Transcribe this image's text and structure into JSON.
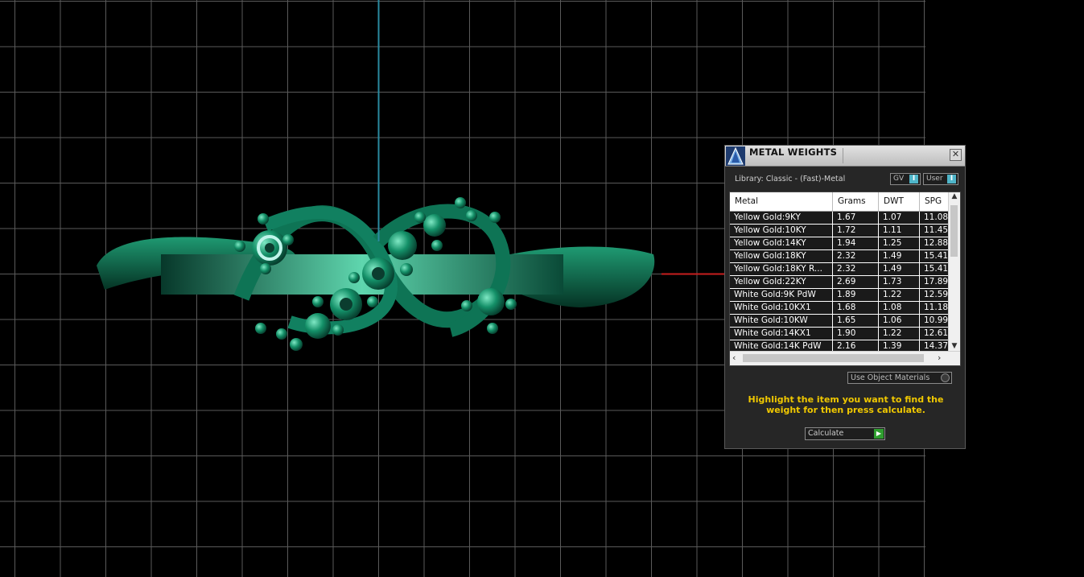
{
  "panel": {
    "title": "METAL WEIGHTS",
    "close_icon": "close-icon",
    "library_label": "Library: Classic - (Fast)-Metal",
    "toggles": [
      {
        "label": "GV"
      },
      {
        "label": "User"
      }
    ],
    "table": {
      "columns": [
        "Metal",
        "Grams",
        "DWT",
        "SPG"
      ],
      "rows": [
        [
          "Yellow Gold:9KY",
          "1.67",
          "1.07",
          "11.08"
        ],
        [
          "Yellow Gold:10KY",
          "1.72",
          "1.11",
          "11.45"
        ],
        [
          "Yellow Gold:14KY",
          "1.94",
          "1.25",
          "12.88"
        ],
        [
          "Yellow Gold:18KY",
          "2.32",
          "1.49",
          "15.41"
        ],
        [
          "Yellow Gold:18KY R...",
          "2.32",
          "1.49",
          "15.41"
        ],
        [
          "Yellow Gold:22KY",
          "2.69",
          "1.73",
          "17.89"
        ],
        [
          "White Gold:9K PdW",
          "1.89",
          "1.22",
          "12.59"
        ],
        [
          "White Gold:10KX1",
          "1.68",
          "1.08",
          "11.18"
        ],
        [
          "White Gold:10KW",
          "1.65",
          "1.06",
          "10.99"
        ],
        [
          "White Gold:14KX1",
          "1.90",
          "1.22",
          "12.61"
        ],
        [
          "White Gold:14K PdW",
          "2.16",
          "1.39",
          "14.37"
        ]
      ]
    },
    "use_object_materials": "Use Object Materials",
    "hint": "Highlight the item you want to find the weight for then press calculate.",
    "calculate_label": "Calculate"
  },
  "colors": {
    "background": "#000000",
    "grid": "#5a5a5a",
    "axis_vertical": "#2a8aa0",
    "axis_horizontal": "#c81e1e",
    "model": "#0f6e50",
    "hint_text": "#f0c800"
  }
}
